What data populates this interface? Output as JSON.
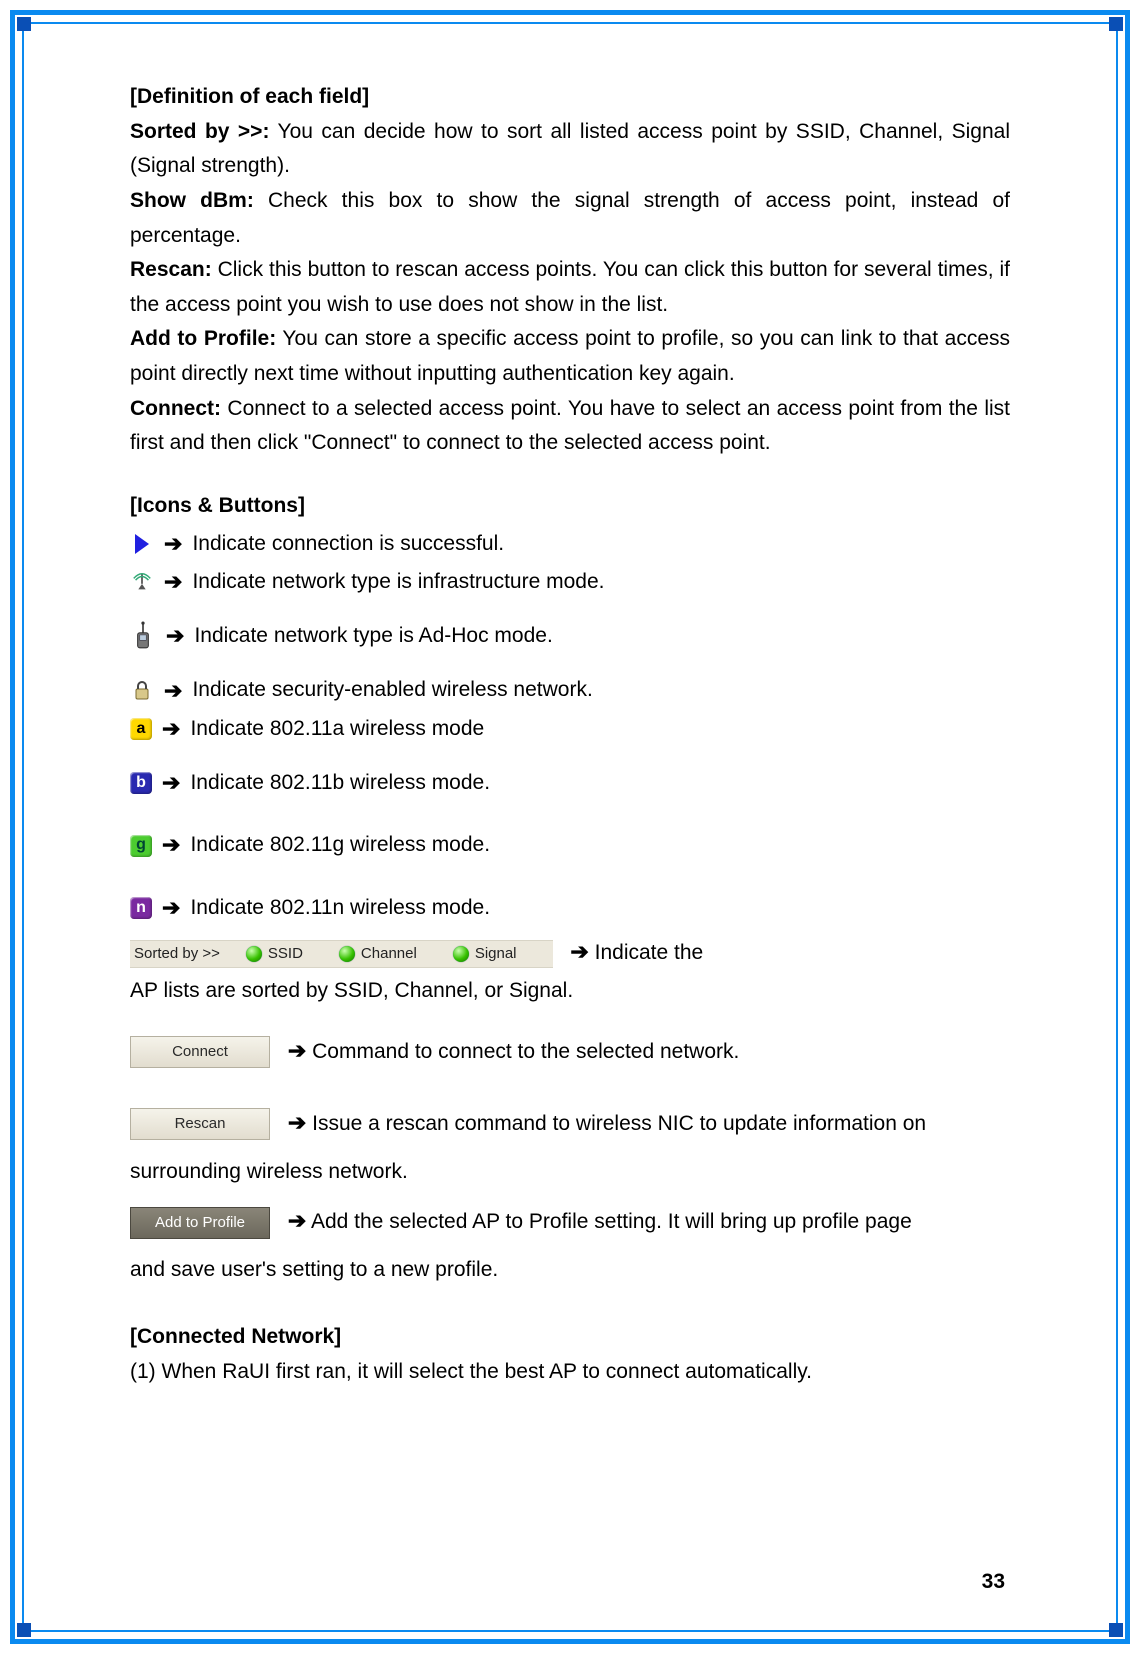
{
  "sections": {
    "def_title": "[Definition of each field]",
    "sorted_label": "Sorted by >>:",
    "sorted_text": " You can decide how to sort all listed access point by SSID, Channel, Signal (Signal strength).",
    "showdbm_label": "Show dBm:",
    "showdbm_text": " Check this box to show the signal strength of access point, instead of percentage.",
    "rescan_label": "Rescan:",
    "rescan_text": " Click this button to rescan access points. You can click this button for several times, if the access point you wish to use does not show in the list.",
    "addprofile_label": "Add to Profile:",
    "addprofile_text": " You can store a specific access point to profile, so you can link to that access point directly next time without inputting authentication key again.",
    "connect_label": "Connect:",
    "connect_text": " Connect to a selected access point. You have to select an access point from the list first and then click \"Connect\" to connect to the selected access point.",
    "icons_title": "[Icons & Buttons]"
  },
  "arrow": "➔",
  "icons": {
    "successful": "Indicate connection is successful.",
    "infra": "Indicate network type is infrastructure mode.",
    "adhoc": "Indicate network type is Ad-Hoc mode.",
    "security": "Indicate security-enabled wireless network.",
    "mode_a": "Indicate 802.11a wireless mode",
    "mode_b": "Indicate 802.11b wireless mode.",
    "mode_g": "Indicate 802.11g wireless mode.",
    "mode_n": "Indicate 802.11n wireless mode."
  },
  "sortbar": {
    "label": "Sorted by >>",
    "opt1": "SSID",
    "opt2": "Channel",
    "opt3": "Signal",
    "desc_lead": "Indicate the",
    "desc_rest": "AP lists are sorted by SSID, Channel, or Signal."
  },
  "buttons": {
    "connect": "Connect",
    "connect_desc": "Command to connect to the selected network.",
    "rescan": "Rescan",
    "rescan_desc_lead": "Issue a rescan command to wireless NIC to update information on",
    "rescan_desc_rest": "surrounding wireless network.",
    "add": "Add to Profile",
    "add_desc_lead": "Add the selected AP to Profile setting. It will bring up profile page",
    "add_desc_rest": "and save user's setting to a new profile."
  },
  "connected": {
    "title": "[Connected Network]",
    "item1": "(1) When RaUI first ran, it will select the best AP to connect automatically."
  },
  "page_number": "33",
  "badges": {
    "a": "a",
    "b": "b",
    "g": "g",
    "n": "n"
  }
}
